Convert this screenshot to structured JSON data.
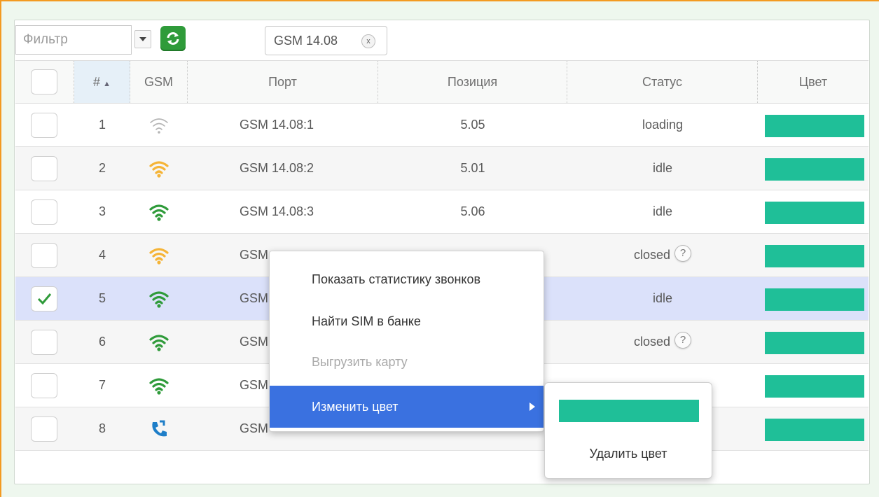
{
  "toolbar": {
    "filter_placeholder": "Фильтр",
    "tag_label": "GSM 14.08",
    "tag_close": "x"
  },
  "table": {
    "columns": {
      "num": "#",
      "gsm": "GSM",
      "port": "Порт",
      "position": "Позиция",
      "status": "Статус",
      "color": "Цвет"
    },
    "rows": [
      {
        "num": "1",
        "signal": "weak-gray",
        "port": "GSM 14.08:1",
        "position": "5.05",
        "status": "loading",
        "help": false,
        "selected": false,
        "color": "#1fbf98"
      },
      {
        "num": "2",
        "signal": "medium-orange",
        "port": "GSM 14.08:2",
        "position": "5.01",
        "status": "idle",
        "help": false,
        "selected": false,
        "color": "#1fbf98"
      },
      {
        "num": "3",
        "signal": "strong-green",
        "port": "GSM 14.08:3",
        "position": "5.06",
        "status": "idle",
        "help": false,
        "selected": false,
        "color": "#1fbf98"
      },
      {
        "num": "4",
        "signal": "medium-orange",
        "port": "GSM",
        "position": "",
        "status": "closed",
        "help": true,
        "selected": false,
        "color": "#1fbf98"
      },
      {
        "num": "5",
        "signal": "strong-green",
        "port": "GSM",
        "position": "",
        "status": "idle",
        "help": false,
        "selected": true,
        "color": "#1fbf98"
      },
      {
        "num": "6",
        "signal": "strong-green",
        "port": "GSM",
        "position": "",
        "status": "closed",
        "help": true,
        "selected": false,
        "color": "#1fbf98"
      },
      {
        "num": "7",
        "signal": "strong-green",
        "port": "GSM",
        "position": "",
        "status": "",
        "help": false,
        "selected": false,
        "color": "#1fbf98"
      },
      {
        "num": "8",
        "signal": "call-blue",
        "port": "GSM",
        "position": "",
        "status": "",
        "help": false,
        "selected": false,
        "color": "#1fbf98"
      }
    ],
    "help_mark": "?"
  },
  "context_menu": {
    "items": [
      {
        "label": "Показать статистику звонков",
        "disabled": false
      },
      {
        "label": "Найти SIM в банке",
        "disabled": false
      },
      {
        "label": "Выгрузить карту",
        "disabled": true
      },
      {
        "label": "Изменить цвет",
        "disabled": false,
        "active": true
      }
    ]
  },
  "submenu": {
    "swatch_color": "#1fbf98",
    "remove_label": "Удалить цвет"
  },
  "colors": {
    "accent_orange": "#f39a21",
    "refresh_green": "#2f9b3a",
    "menu_active_blue": "#3a71e0",
    "row_selected": "#dbe1fa",
    "teal_swatch": "#1fbf98",
    "signal_green": "#2f9b3a",
    "signal_orange": "#f5b437",
    "signal_gray": "#b5b5b5",
    "call_blue": "#1e7ec8"
  }
}
